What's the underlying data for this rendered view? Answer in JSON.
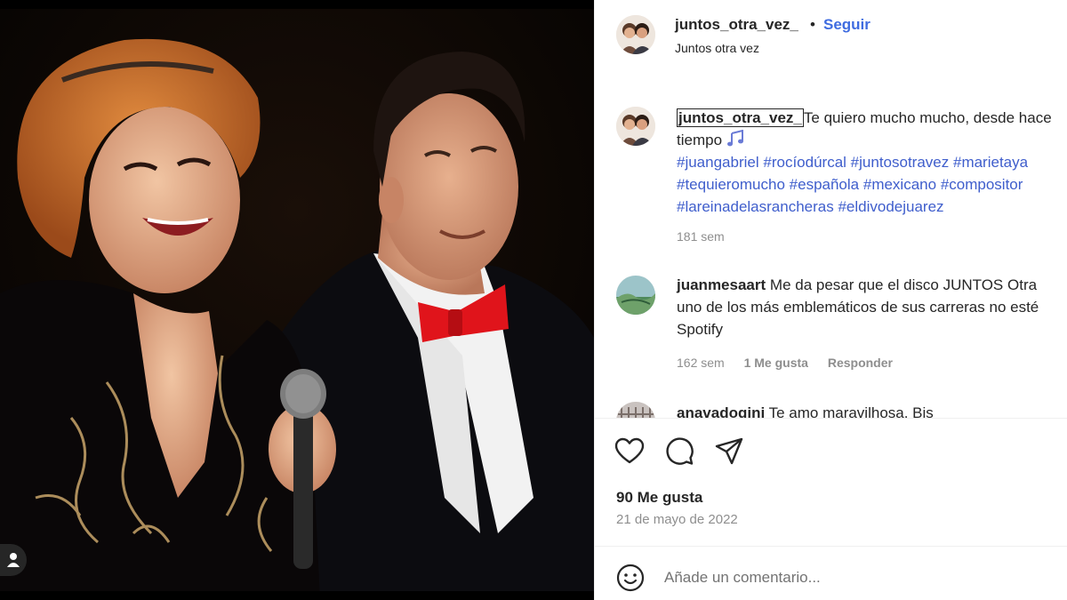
{
  "post": {
    "username": "juntos_otra_vez_",
    "follow_label": "Seguir",
    "subtitle": "Juntos otra vez",
    "likes": "90 Me gusta",
    "date": "21 de mayo de 2022"
  },
  "caption": {
    "username": "juntos_otra_vez_",
    "text_line1": "Te quiero mucho mucho, desde hace",
    "text_line2": "tiempo",
    "tags_line1": [
      "#juangabriel",
      "#rocíodúrcal",
      "#juntosotravez",
      "#marietaya"
    ],
    "tags_line2": [
      "#tequieromucho",
      "#española",
      "#mexicano",
      "#compositor"
    ],
    "tags_line3": [
      "#lareinadelasrancheras",
      "#eldivodejuarez"
    ],
    "time": "181 sem"
  },
  "comments": [
    {
      "username": "juanmesaart",
      "line1": "Me da pesar que el disco JUNTOS Otra",
      "line2": "uno de los más emblemáticos de sus carreras no esté",
      "line3": "Spotify",
      "time": "162 sem",
      "likes": "1 Me gusta",
      "reply_label": "Responder"
    },
    {
      "username": "anavadogini",
      "line1": "Te amo maravilhosa. Bis"
    }
  ],
  "add_comment": {
    "placeholder": "Añade un comentario..."
  },
  "icons": {
    "like": "heart-icon",
    "comment": "comment-icon",
    "share": "send-icon",
    "emoji": "smiley-icon",
    "music": "music-notes-icon",
    "profile": "user-icon"
  },
  "colors": {
    "link": "#3f6ce0",
    "hashtag": "#3f5ecc",
    "muted": "#8e8e8e",
    "text": "#262626"
  }
}
